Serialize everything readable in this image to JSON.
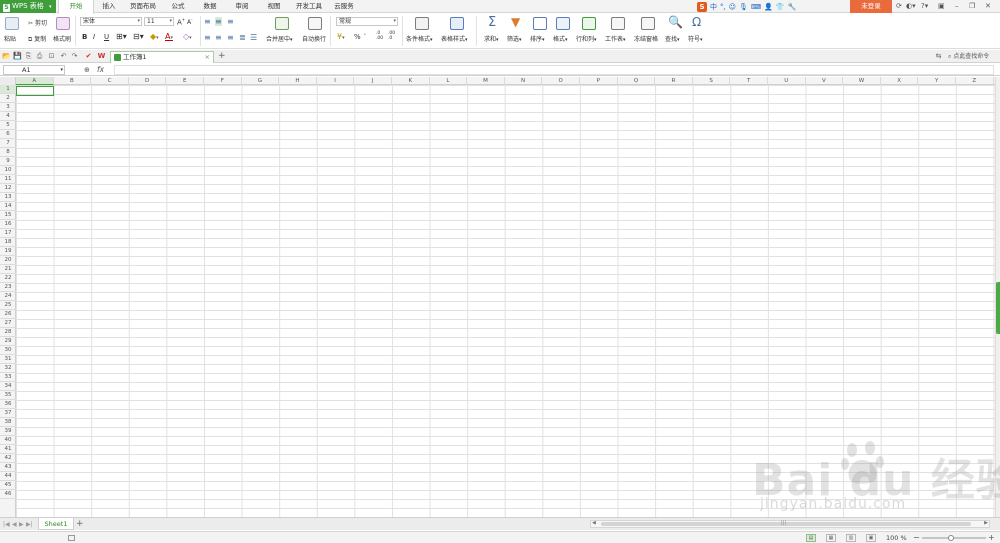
{
  "titlebar": {
    "app_name": "WPS 表格",
    "menu_tabs": [
      "开始",
      "插入",
      "页面布局",
      "公式",
      "数据",
      "审阅",
      "视图",
      "开发工具",
      "云服务"
    ],
    "active_tab": "开始",
    "ime_label": "中",
    "login": "未登录"
  },
  "ribbon": {
    "paste": "粘贴",
    "cut": "剪切",
    "copy": "复制",
    "format_painter": "格式刷",
    "font_name": "宋体",
    "font_size": "11",
    "bold": "B",
    "italic": "I",
    "underline": "U",
    "merge_center": "合并居中",
    "auto_wrap": "自动换行",
    "number_format": "常规",
    "percent": "%",
    "conditional_format": "条件格式",
    "table_style": "表格样式",
    "sum": "求和",
    "filter": "筛选",
    "sort": "排序",
    "format": "格式",
    "row_col": "行和列",
    "worksheet": "工作表",
    "freeze": "冻结窗格",
    "find": "查找",
    "symbol": "符号"
  },
  "quickbar": {
    "doc_name": "工作簿1",
    "command_search": "点此查找命令"
  },
  "formula": {
    "cell_ref": "A1",
    "fx": "fx",
    "value": ""
  },
  "sheet": {
    "columns": [
      "A",
      "B",
      "C",
      "D",
      "E",
      "F",
      "G",
      "H",
      "I",
      "J",
      "K",
      "L",
      "M",
      "N",
      "O",
      "P",
      "Q",
      "R",
      "S",
      "T",
      "U",
      "V",
      "W",
      "X",
      "Y",
      "Z"
    ],
    "row_count": 46,
    "selected_col": "A",
    "selected_row": 1,
    "tab_name": "Sheet1"
  },
  "status": {
    "zoom": "100 %",
    "zoom_fraction": 0.45
  },
  "watermark": {
    "main": "Bai du 经验",
    "sub": "jingyan.baidu.com"
  },
  "colors": {
    "accent": "#3f9d3b",
    "login": "#e96a3b",
    "ime": "#e55a1c"
  }
}
